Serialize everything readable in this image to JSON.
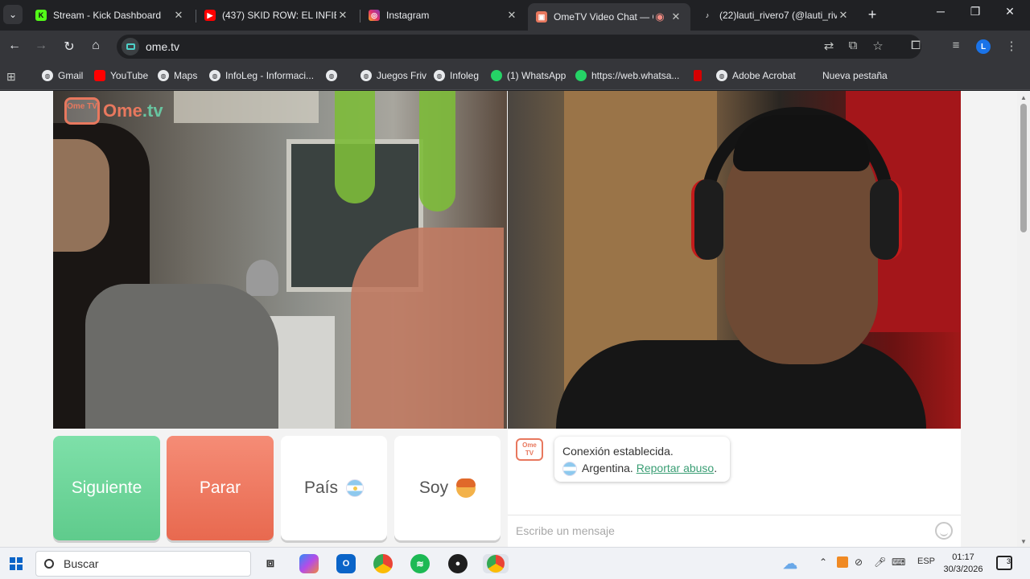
{
  "browser": {
    "tabs": [
      {
        "title": "Stream - Kick Dashboard",
        "icon": "kick-icon",
        "color": "#53fc18",
        "letter": "K"
      },
      {
        "title": "(437) SKID ROW: EL INFIERNO",
        "icon": "youtube-icon",
        "color": "#ff0000",
        "letter": "▶"
      },
      {
        "title": "Instagram",
        "icon": "instagram-icon",
        "color": "#e1306c",
        "letter": "◎"
      },
      {
        "title": "OmeTV Video Chat — C",
        "icon": "ometv-icon",
        "color": "#e8785e",
        "letter": "▣",
        "active": true
      },
      {
        "title": "(22)lauti_rivero7 (@lauti_rive",
        "icon": "tiktok-icon",
        "color": "#202124",
        "letter": "♪"
      }
    ],
    "new_tab": "+",
    "window_controls": {
      "minimize": "─",
      "restore": "❐",
      "close": "✕"
    },
    "url": "ome.tv",
    "profile_letter": "L",
    "bookmarks": [
      {
        "label": "Gmail"
      },
      {
        "label": "YouTube"
      },
      {
        "label": "Maps"
      },
      {
        "label": "InfoLeg - Informaci..."
      },
      {
        "label": ""
      },
      {
        "label": "Juegos Friv"
      },
      {
        "label": "Infoleg"
      },
      {
        "label": "(1) WhatsApp"
      },
      {
        "label": "https://web.whatsa..."
      },
      {
        "label": ""
      },
      {
        "label": "Adobe Acrobat"
      },
      {
        "label": "Nueva pestaña"
      }
    ]
  },
  "ometv": {
    "logo_box": "Ome TV",
    "logo_word": "Ome",
    "logo_tld": ".tv",
    "buttons": {
      "next": "Siguiente",
      "stop": "Parar",
      "country": "País",
      "gender": "Soy"
    },
    "colors": {
      "next": "#5fcb8c",
      "stop": "#e8694f",
      "brand": "#e8785e"
    },
    "chat": {
      "avatar_text": "Ome TV",
      "status": "Conexión establecida.",
      "country": "Argentina.",
      "report_link": "Reportar abuso",
      "report_suffix": ".",
      "input_placeholder": "Escribe un mensaje"
    }
  },
  "taskbar": {
    "search_label": "Buscar",
    "language": "ESP",
    "time": "01:17",
    "date": "30/3/2026",
    "notifications": "3"
  }
}
